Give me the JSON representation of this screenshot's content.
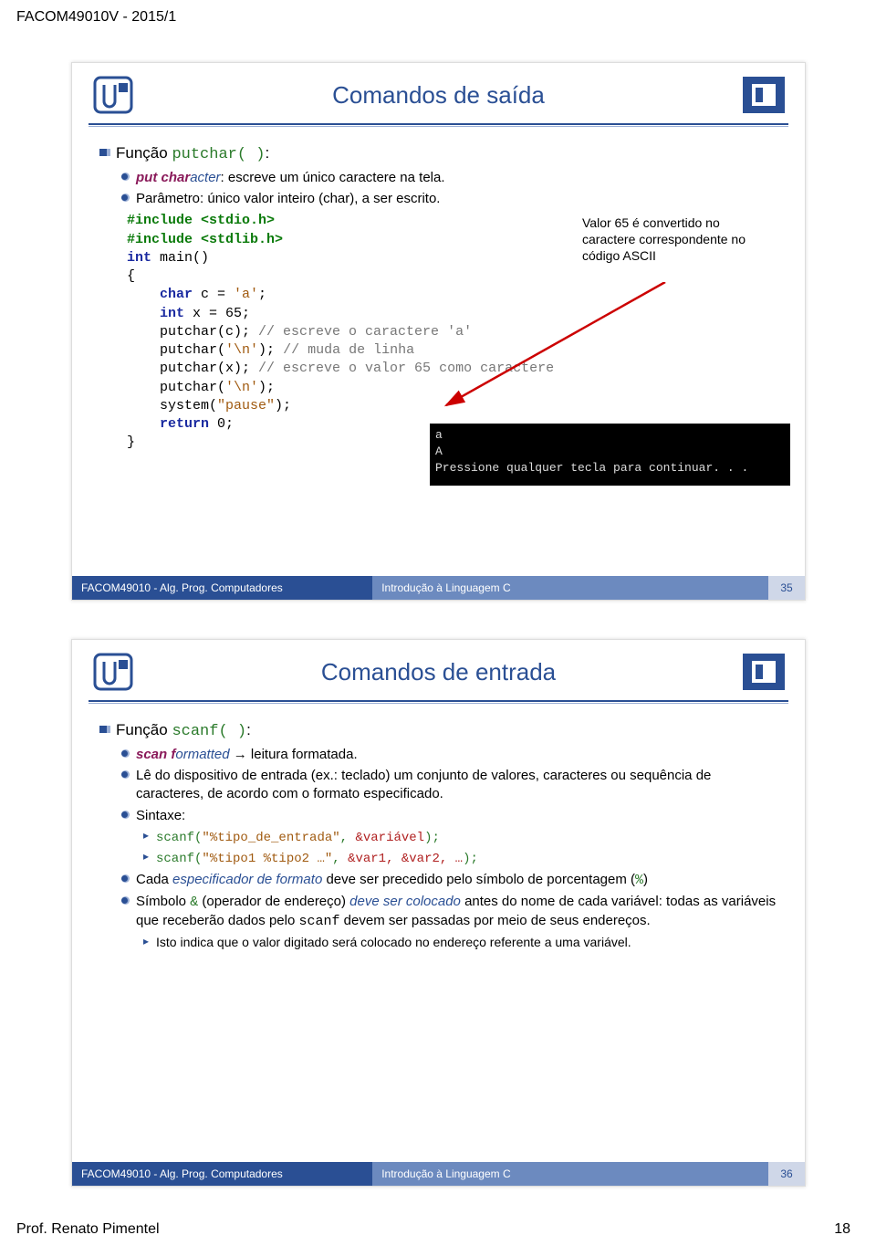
{
  "page": {
    "header": "FACOM49010V - 2015/1",
    "footer_left": "Prof. Renato Pimentel",
    "footer_right": "18"
  },
  "slide1": {
    "title": "Comandos de saída",
    "b1": "Função ",
    "b1_code": "putchar( )",
    "b1_tail": ":",
    "b2a_ital": "put char",
    "b2a_ital2": "acter",
    "b2a_rest": ": escreve um único caractere na tela.",
    "b2b": "Parâmetro: único valor inteiro (char), a ser escrito.",
    "code_l1": "#include <stdio.h>",
    "code_l2": "#include <stdlib.h>",
    "code_l3a": "int",
    "code_l3b": " main()",
    "code_l4": "{",
    "code_l5a": "    char",
    "code_l5b": " c = ",
    "code_l5c": "'a'",
    "code_l5d": ";",
    "code_l6a": "    int",
    "code_l6b": " x = 65;",
    "code_l7": "    putchar(c); ",
    "code_l7c": "// escreve o caractere 'a'",
    "code_l8": "    putchar(",
    "code_l8s": "'\\n'",
    "code_l8t": "); ",
    "code_l8c": "// muda de linha",
    "code_l9": "    putchar(x); ",
    "code_l9c": "// escreve o valor 65 como caractere",
    "code_l10": "    putchar(",
    "code_l10s": "'\\n'",
    "code_l10t": ");",
    "code_l11": "    system(",
    "code_l11s": "\"pause\"",
    "code_l11t": ");",
    "code_l12a": "    return",
    "code_l12b": " 0;",
    "code_l13": "}",
    "callout": "Valor 65 é convertido no caractere correspondente no código ASCII",
    "term": "a\nA\nPressione qualquer tecla para continuar. . .",
    "footer_a": "FACOM49010 - Alg. Prog. Computadores",
    "footer_b": "Introdução à Linguagem C",
    "footer_c": "35"
  },
  "slide2": {
    "title": "Comandos de entrada",
    "b1": "Função ",
    "b1_code": "scanf( )",
    "b1_tail": ":",
    "b2a_ital": "scan f",
    "b2a_ital2": "ormatted",
    "b2a_rest": " → leitura formatada.",
    "b2b": "Lê do dispositivo de entrada (ex.: teclado) um conjunto de valores, caracteres ou sequência de caracteres, de acordo com o formato especificado.",
    "b2c": "Sintaxe:",
    "b3a_pre": "scanf(",
    "b3a_str": "\"%tipo_de_entrada\"",
    "b3a_mid": ", ",
    "b3a_var": "&variável",
    "b3a_tail": ");",
    "b3b_pre": "scanf(",
    "b3b_str": "\"%tipo1 %tipo2 …\"",
    "b3b_mid": ", ",
    "b3b_var": "&var1, &var2, …",
    "b3b_tail": ");",
    "b2d_a": "Cada ",
    "b2d_it": "especificador de formato",
    "b2d_b": " deve ser precedido pelo símbolo de porcentagem (",
    "b2d_code": "%",
    "b2d_c": ")",
    "b2e_a": "Símbolo ",
    "b2e_code": "&",
    "b2e_b": " (operador de endereço) ",
    "b2e_it": "deve ser colocado",
    "b2e_c": " antes do nome de cada variável: todas as variáveis que receberão dados pelo ",
    "b2e_code2": "scanf",
    "b2e_d": " devem ser passadas por meio de seus endereços.",
    "b3c": "Isto indica que o valor digitado será colocado no endereço referente a uma variável.",
    "footer_a": "FACOM49010 - Alg. Prog. Computadores",
    "footer_b": "Introdução à Linguagem C",
    "footer_c": "36"
  }
}
